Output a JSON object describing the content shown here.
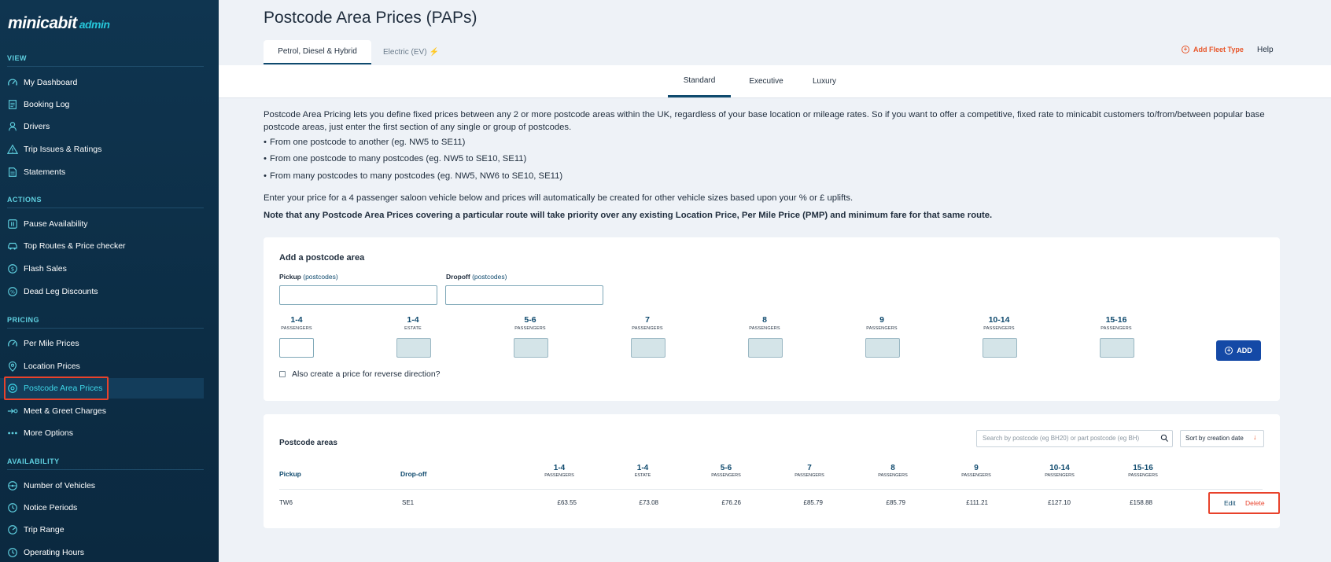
{
  "brand": {
    "logo_text": "minicabit",
    "logo_suffix": "admin"
  },
  "sidebar": {
    "sections": [
      {
        "title": "VIEW",
        "items": [
          {
            "label": "My Dashboard",
            "icon": "gauge-icon"
          },
          {
            "label": "Booking Log",
            "icon": "document-icon"
          },
          {
            "label": "Drivers",
            "icon": "driver-icon"
          },
          {
            "label": "Trip Issues & Ratings",
            "icon": "warning-icon"
          },
          {
            "label": "Statements",
            "icon": "statement-icon"
          }
        ]
      },
      {
        "title": "ACTIONS",
        "items": [
          {
            "label": "Pause Availability",
            "icon": "pause-icon"
          },
          {
            "label": "Top Routes & Price checker",
            "icon": "car-icon"
          },
          {
            "label": "Flash Sales",
            "icon": "dollar-circle-icon"
          },
          {
            "label": "Dead Leg Discounts",
            "icon": "discount-icon"
          }
        ]
      },
      {
        "title": "PRICING",
        "items": [
          {
            "label": "Per Mile Prices",
            "icon": "gauge-icon"
          },
          {
            "label": "Location Prices",
            "icon": "pin-icon"
          },
          {
            "label": "Postcode Area Prices",
            "icon": "target-icon",
            "active": true
          },
          {
            "label": "Meet & Greet Charges",
            "icon": "meet-greet-icon"
          },
          {
            "label": "More Options",
            "icon": "dots-icon"
          }
        ]
      },
      {
        "title": "AVAILABILITY",
        "items": [
          {
            "label": "Number of Vehicles",
            "icon": "wheel-icon"
          },
          {
            "label": "Notice Periods",
            "icon": "clock-icon"
          },
          {
            "label": "Trip Range",
            "icon": "range-icon"
          },
          {
            "label": "Operating Hours",
            "icon": "clock-icon"
          }
        ]
      }
    ]
  },
  "header": {
    "title": "Postcode Area Prices (PAPs)",
    "fuel_tabs": [
      "Petrol, Diesel & Hybrid",
      "Electric (EV)"
    ],
    "add_fleet_type": "Add Fleet Type",
    "help": "Help"
  },
  "tier_tabs": [
    "Standard",
    "Executive",
    "Luxury"
  ],
  "description": {
    "intro": "Postcode Area Pricing lets you define fixed prices between any 2 or more postcode areas within the UK, regardless of your base location or mileage rates. So if you want to offer a competitive, fixed rate to minicabit customers to/from/between popular base postcode areas, just enter the first section of any single or group of postcodes.",
    "bullets": [
      "From one postcode to another (eg. NW5 to SE11)",
      "From one postcode to many postcodes (eg. NW5 to SE10, SE11)",
      "From many postcodes to many postcodes (eg. NW5, NW6 to SE10, SE11)"
    ],
    "uplift": "Enter your price for a 4 passenger saloon vehicle below and prices will automatically be created for other vehicle sizes based upon your % or £ uplifts.",
    "note": "Note that any Postcode Area Prices covering a particular route will take priority over any existing Location Price, Per Mile Price (PMP) and minimum fare for that same route."
  },
  "add_form": {
    "title": "Add a postcode area",
    "pickup_label": "Pickup",
    "pickup_hint": "(postcodes)",
    "dropoff_label": "Dropoff",
    "dropoff_hint": "(postcodes)",
    "vehicle_columns": [
      {
        "size": "1-4",
        "type": "PASSENGERS"
      },
      {
        "size": "1-4",
        "type": "ESTATE"
      },
      {
        "size": "5-6",
        "type": "PASSENGERS"
      },
      {
        "size": "7",
        "type": "PASSENGERS"
      },
      {
        "size": "8",
        "type": "PASSENGERS"
      },
      {
        "size": "9",
        "type": "PASSENGERS"
      },
      {
        "size": "10-14",
        "type": "PASSENGERS"
      },
      {
        "size": "15-16",
        "type": "PASSENGERS"
      }
    ],
    "add_button": "ADD",
    "reverse_label": "Also create a price for reverse direction?"
  },
  "postcode_areas": {
    "title": "Postcode areas",
    "search_placeholder": "Search by postcode (eg BH20) or part postcode (eg BH)",
    "sort_label": "Sort by creation date",
    "columns": {
      "pickup": "Pickup",
      "dropoff": "Drop-off"
    },
    "rows": [
      {
        "pickup": "TW6",
        "dropoff": "SE1",
        "prices": [
          "£63.55",
          "£73.08",
          "£76.26",
          "£85.79",
          "£85.79",
          "£111.21",
          "£127.10",
          "£158.88"
        ],
        "edit": "Edit",
        "delete": "Delete"
      }
    ]
  },
  "colors": {
    "sidebar_bg": "#0f3550",
    "accent_cyan": "#3fd7e8",
    "primary_blue": "#1449a6",
    "orange": "#e8572b",
    "highlight_red": "#e8422b"
  }
}
